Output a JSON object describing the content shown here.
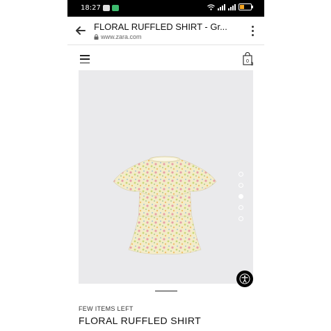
{
  "status_bar": {
    "time": "18:27"
  },
  "browser": {
    "title": "FLORAL RUFFLED SHIRT - Gr...",
    "url": "www.zara.com"
  },
  "product": {
    "stock_label": "FEW ITEMS LEFT",
    "name": "FLORAL RUFFLED SHIRT",
    "image_count": 5,
    "active_image": 3
  },
  "colors": {
    "battery": "#f5a623",
    "image_bg": "#eaeaec"
  }
}
